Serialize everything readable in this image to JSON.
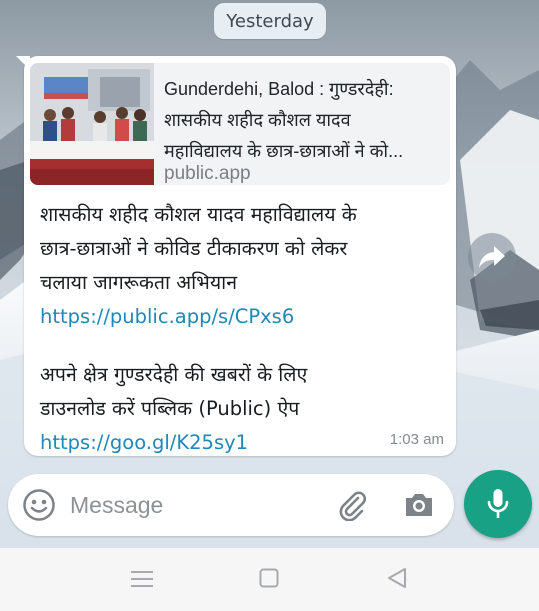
{
  "date_divider": "Yesterday",
  "link_preview": {
    "title_lines": [
      "Gunderdehi, Balod : गुण्डरदेही:",
      "शासकीय शहीद कौशल यादव",
      "महाविद्यालय के छात्र-छात्राओं ने को..."
    ],
    "domain": "public.app",
    "thumbnail_icon": "news-photo-thumbnail"
  },
  "message": {
    "lines_para1": [
      "शासकीय शहीद कौशल यादव महाविद्यालय के",
      "छात्र-छात्राओं ने कोविड टीकाकरण को लेकर",
      "चलाया जागरूकता अभियान"
    ],
    "link1": "https://public.app/s/CPxs6",
    "lines_para2": [
      "अपने क्षेत्र गुण्डरदेही की खबरों के लिए",
      "डाउनलोड करें पब्लिक (Public) ऐप"
    ],
    "link2": "https://goo.gl/K25sy1",
    "time": "1:03 am"
  },
  "composer": {
    "placeholder": "Message"
  },
  "icons": {
    "forward": "forward-icon",
    "emoji": "emoji-icon",
    "attach": "paperclip-icon",
    "camera": "camera-icon",
    "mic": "microphone-icon",
    "nav_menu": "recent-apps-icon",
    "nav_home": "home-icon",
    "nav_back": "back-icon"
  },
  "colors": {
    "accent": "#19a185",
    "link": "#1e88b8",
    "bubble": "#ffffff",
    "date_chip": "#e7eef3"
  }
}
